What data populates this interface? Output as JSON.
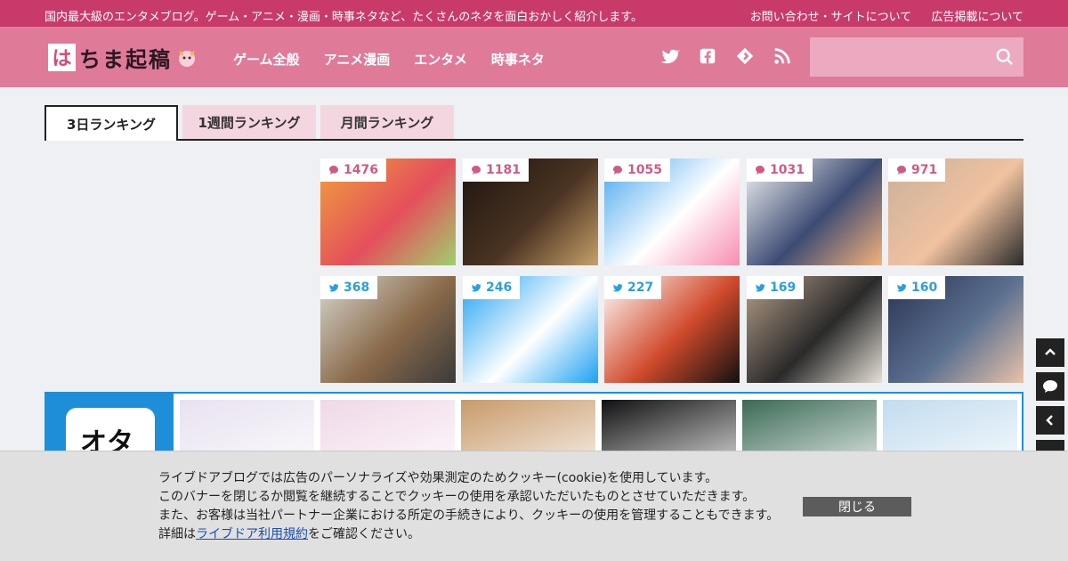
{
  "topbar": {
    "tagline": "国内最大級のエンタメブログ。ゲーム・アニメ・漫画・時事ネタなど、たくさんのネタを面白おかしく紹介します。",
    "links": [
      "お問い合わせ・サイトについて",
      "広告掲載について"
    ]
  },
  "header": {
    "logo_mark": "は",
    "logo_text": "ちま起稿",
    "nav": [
      "ゲーム全般",
      "アニメ漫画",
      "エンタメ",
      "時事ネタ"
    ],
    "social_icons": [
      "twitter-icon",
      "facebook-icon",
      "feedly-icon",
      "rss-icon"
    ],
    "search_placeholder": "",
    "search_icon": "search-icon"
  },
  "ranking": {
    "tabs": [
      "3日ランキング",
      "1週間ランキング",
      "月間ランキング"
    ],
    "active_tab": "3日ランキング",
    "comment_row": [
      {
        "count": "1476",
        "icon": "comment-icon",
        "colors": [
          "#f0a23c",
          "#e44f5c",
          "#9ed06d"
        ]
      },
      {
        "count": "1181",
        "icon": "comment-icon",
        "colors": [
          "#1c140f",
          "#4a3322",
          "#c7a06a"
        ]
      },
      {
        "count": "1055",
        "icon": "comment-icon",
        "colors": [
          "#48a6f0",
          "#ffffff",
          "#f78db0"
        ]
      },
      {
        "count": "1031",
        "icon": "comment-icon",
        "colors": [
          "#f7f7f7",
          "#3d4b73",
          "#f3b27a"
        ]
      },
      {
        "count": "971",
        "icon": "comment-icon",
        "colors": [
          "#c9b099",
          "#f0c2a0",
          "#2a2a2a"
        ]
      }
    ],
    "tweet_row": [
      {
        "count": "368",
        "icon": "twitter-icon",
        "colors": [
          "#d8d8d0",
          "#8a6a4a",
          "#3a3a3a"
        ]
      },
      {
        "count": "246",
        "icon": "twitter-icon",
        "colors": [
          "#1da1f2",
          "#ffffff",
          "#1da1f2"
        ]
      },
      {
        "count": "227",
        "icon": "twitter-icon",
        "colors": [
          "#ffffff",
          "#d04a2c",
          "#111111"
        ]
      },
      {
        "count": "169",
        "icon": "twitter-icon",
        "colors": [
          "#b8a08a",
          "#2a2a2a",
          "#e6e0d6"
        ]
      },
      {
        "count": "160",
        "icon": "twitter-icon",
        "colors": [
          "#2a3352",
          "#5c7090",
          "#e8c2a8"
        ]
      }
    ]
  },
  "otakuma": {
    "logo_text": "オタ",
    "colors": [
      "#e8e2f0",
      "#f0d8e8",
      "#c89a6a",
      "#101010",
      "#3b6a56",
      "#c2dcef"
    ]
  },
  "cookie_banner": {
    "lines": [
      "ライブドアブログでは広告のパーソナライズや効果測定のためクッキー(cookie)を使用しています。",
      "このバナーを閉じるか閲覧を継続することでクッキーの使用を承認いただいたものとさせていただきます。",
      "また、お客様は当社パートナー企業における所定の手続きにより、クッキーの使用を管理することもできます。"
    ],
    "last_line_prefix": "詳細は",
    "link_text": "ライブドア利用規約",
    "last_line_suffix": "をご確認ください。",
    "close_label": "閉じる"
  },
  "side_buttons": [
    "chevron-up-icon",
    "comment-icon",
    "chevron-left-icon"
  ],
  "colors": {
    "accent": "#c83a6a",
    "header": "#e07a99",
    "tab_inactive": "#f4d6e0",
    "ota_blue": "#1f8ed8"
  }
}
